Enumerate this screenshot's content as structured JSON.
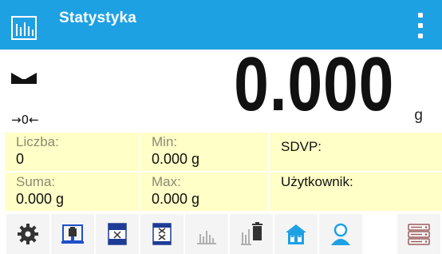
{
  "header": {
    "title": "Statystyka",
    "app_icon": "statistics-icon",
    "menu_icon": "vertical-dots-icon",
    "background": "#1ea1e3"
  },
  "display": {
    "weight": "0.000",
    "unit": "g",
    "zero_indicator": "→0←",
    "stability_icon": "stability-marker-icon"
  },
  "info": {
    "liczba_label": "Liczba:",
    "liczba_value": "0",
    "suma_label": "Suma:",
    "suma_value": "0.000 g",
    "min_label": "Min:",
    "min_value": "0.000 g",
    "max_label": "Max:",
    "max_value": "0.000 g",
    "sdvp_label": "SDVP:",
    "user_label": "Użytkownik:",
    "background": "#ffffc7"
  },
  "toolbar": {
    "buttons": [
      "settings-icon",
      "tare-icon",
      "record-icon",
      "delete-record-icon",
      "statistics-icon",
      "clear-statistics-icon",
      "home-icon",
      "user-icon",
      "database-icon"
    ]
  }
}
